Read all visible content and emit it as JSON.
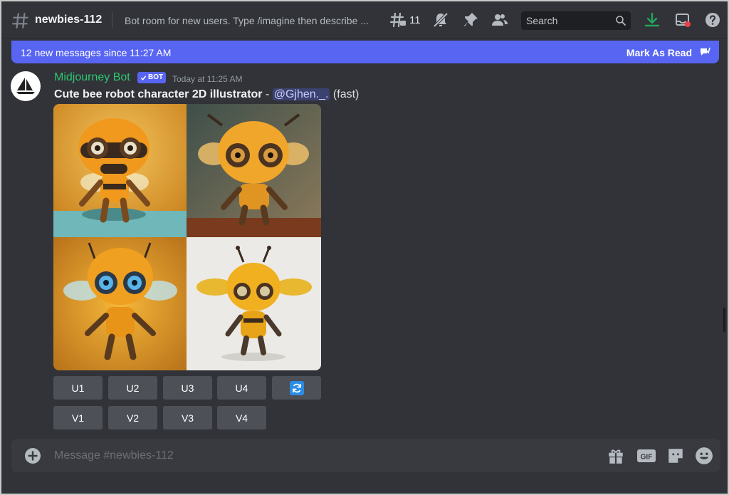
{
  "header": {
    "channel_name": "newbies-112",
    "topic": "Bot room for new users. Type /imagine then describe ...",
    "threads_count": "11",
    "search_placeholder": "Search"
  },
  "banner": {
    "new_messages": "12 new messages since 11:27 AM",
    "mark_as_read": "Mark As Read"
  },
  "message": {
    "author": "Midjourney Bot",
    "bot_tag": "BOT",
    "timestamp": "Today at 11:25 AM",
    "prompt": "Cute bee robot character 2D illustrator",
    "separator": " - ",
    "mention": "@Gjhen._.",
    "speed": "(fast)"
  },
  "buttons": {
    "upscale": [
      "U1",
      "U2",
      "U3",
      "U4"
    ],
    "variation": [
      "V1",
      "V2",
      "V3",
      "V4"
    ]
  },
  "composer": {
    "placeholder": "Message #newbies-112",
    "gif_label": "GIF"
  },
  "colors": {
    "background": "#313338",
    "accent": "#5865f2",
    "author": "#2dc770",
    "button": "#4e5058"
  },
  "icons": {
    "header": [
      "hash-icon",
      "threads-icon",
      "mute-icon",
      "pin-icon",
      "members-icon",
      "search-icon",
      "download-icon",
      "inbox-icon",
      "help-icon"
    ],
    "composer": [
      "plus-icon",
      "gift-icon",
      "gif-icon",
      "sticker-icon",
      "emoji-icon"
    ],
    "reroll": "refresh-icon"
  }
}
